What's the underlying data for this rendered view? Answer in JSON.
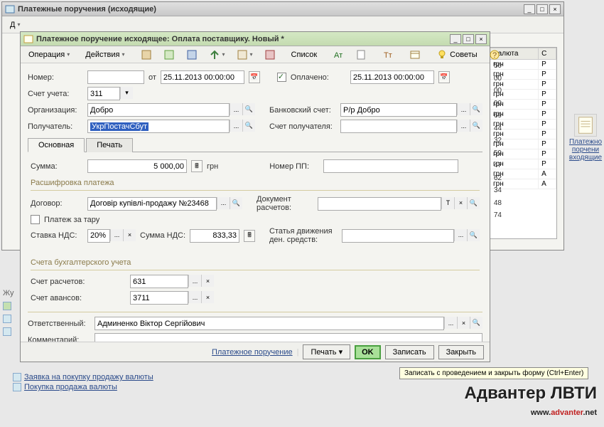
{
  "outer": {
    "title": "Платежные поручения (исходящие)"
  },
  "dialog": {
    "title": "Платежное поручение исходящее: Оплата поставщику. Новый *",
    "toolbar": {
      "operation": "Операция",
      "actions": "Действия",
      "list": "Список",
      "tips": "Советы"
    },
    "fields": {
      "number_lbl": "Номер:",
      "number_val": "",
      "ot": "от",
      "date1": "25.11.2013 00:00:00",
      "paid_lbl": "Оплачено:",
      "date2": "25.11.2013 00:00:00",
      "account_lbl": "Счет учета:",
      "account_val": "311",
      "org_lbl": "Организация:",
      "org_val": "Добро",
      "bank_lbl": "Банковский счет:",
      "bank_val": "Р/р Добро",
      "payee_lbl": "Получатель:",
      "payee_val": "УкрПостачСбут",
      "payee_acct_lbl": "Счет получателя:",
      "payee_acct_val": ""
    },
    "tabs": {
      "main": "Основная",
      "print": "Печать"
    },
    "main": {
      "sum_lbl": "Сумма:",
      "sum_val": "5 000,00",
      "sum_cur": "грн",
      "pp_lbl": "Номер ПП:",
      "pp_val": "",
      "decode_title": "Расшифровка платежа",
      "contract_lbl": "Договор:",
      "contract_val": "Договір купівлі-продажу №23468",
      "doc_lbl": "Документ расчетов:",
      "tare_lbl": "Платеж за тару",
      "vat_rate_lbl": "Ставка НДС:",
      "vat_rate_val": "20%",
      "vat_sum_lbl": "Сумма НДС:",
      "vat_sum_val": "833,33",
      "cashflow_lbl": "Статья движения ден. средств:",
      "acc_title": "Счета бухгалтерского учета",
      "settle_lbl": "Счет расчетов:",
      "settle_val": "631",
      "advance_lbl": "Счет авансов:",
      "advance_val": "3711"
    },
    "resp_lbl": "Ответственный:",
    "resp_val": "Админенко Віктор Сергійович",
    "comment_lbl": "Комментарий:",
    "bottom": {
      "doc": "Платежное поручение",
      "print": "Печать",
      "ok": "OK",
      "save": "Записать",
      "close": "Закрыть"
    }
  },
  "grid": {
    "hdr_cur": "Валюта",
    "hdr_c": "С",
    "rows": [
      {
        "n": "50",
        "cur": "грн",
        "c": "Р"
      },
      {
        "n": "00",
        "cur": "грн",
        "c": "Р"
      },
      {
        "n": "00",
        "cur": "грн",
        "c": "Р"
      },
      {
        "n": "00",
        "cur": "грн",
        "c": "Р"
      },
      {
        "n": "69",
        "cur": "грн",
        "c": "Р"
      },
      {
        "n": "44",
        "cur": "грн",
        "c": "Р"
      },
      {
        "n": "32",
        "cur": "грн",
        "c": "Р"
      },
      {
        "n": "59",
        "cur": "грн",
        "c": "Р"
      },
      {
        "n": "47",
        "cur": "грн",
        "c": "Р"
      },
      {
        "n": "62",
        "cur": "грн",
        "c": "Р"
      },
      {
        "n": "34",
        "cur": "грн",
        "c": "Р"
      },
      {
        "n": "48",
        "cur": "грн",
        "c": "А"
      },
      {
        "n": "74",
        "cur": "грн",
        "c": "А"
      }
    ]
  },
  "sidebar": {
    "line1": "Платежно",
    "line2": "порчени",
    "line3": "входящие"
  },
  "links": {
    "l1": "Заявка на покупку продажу валюты",
    "l2": "Покупка продажа валюты"
  },
  "tooltip": "Записать с проведением и закрыть форму (Ctrl+Enter)",
  "watermark": {
    "t1": "Адвантер ЛВТИ",
    "t2a": "www.",
    "t2b": "advanter",
    "t2c": ".net"
  },
  "journal_label": "Жу"
}
